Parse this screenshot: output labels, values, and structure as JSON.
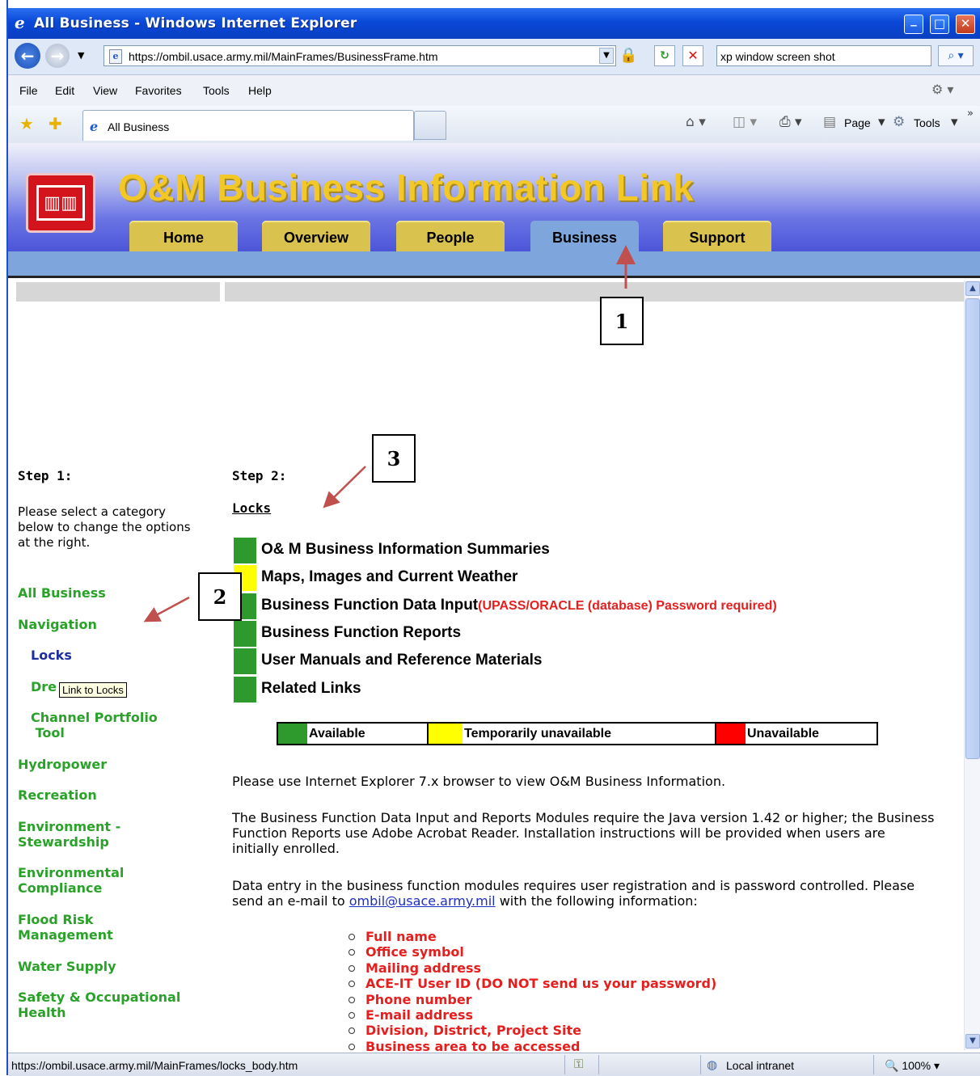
{
  "window": {
    "title": "All Business - Windows Internet Explorer"
  },
  "address_bar": {
    "url": "https://ombil.usace.army.mil/MainFrames/BusinessFrame.htm",
    "search_value": "xp window screen shot"
  },
  "menu": {
    "file": "File",
    "edit": "Edit",
    "view": "View",
    "favorites": "Favorites",
    "tools": "Tools",
    "help": "Help"
  },
  "tabs": {
    "active_label": "All Business"
  },
  "command_bar": {
    "page": "Page",
    "tools": "Tools"
  },
  "site": {
    "title": "O&M Business Information Link",
    "nav": [
      "Home",
      "Overview",
      "People",
      "Business",
      "Support"
    ],
    "active_nav": "Business"
  },
  "left_panel": {
    "step_label": "Step 1:",
    "description": "Please select a category below to change the options at the right.",
    "categories": {
      "all_business": "All Business",
      "navigation": "Navigation",
      "locks": "Locks",
      "dredging_partial": "Dre",
      "channel": "Channel Portfolio\n Tool",
      "hydropower": "Hydropower",
      "recreation": "Recreation",
      "environment": "Environment -\nStewardship",
      "env_compliance": "Environmental\nCompliance",
      "flood": "Flood Risk\nManagement",
      "water": "Water Supply",
      "safety": "Safety & Occupational\nHealth"
    },
    "tooltip": "Link to Locks"
  },
  "right_panel": {
    "step_label": "Step 2:",
    "selected_category": "Locks",
    "options": [
      {
        "label": "O& M Business Information Summaries",
        "status_color": "#2e9a2e",
        "note": ""
      },
      {
        "label": "Maps, Images and Current Weather",
        "status_color": "#ffff00",
        "note": ""
      },
      {
        "label": "Business Function Data Input",
        "status_color": "#2e9a2e",
        "note": "(UPASS/ORACLE (database) Password required)"
      },
      {
        "label": "Business Function Reports",
        "status_color": "#2e9a2e",
        "note": ""
      },
      {
        "label": "User Manuals and Reference Materials",
        "status_color": "#2e9a2e",
        "note": ""
      },
      {
        "label": "Related Links",
        "status_color": "#2e9a2e",
        "note": ""
      }
    ],
    "legend": {
      "available": {
        "label": "Available",
        "color": "#2e9a2e"
      },
      "temp": {
        "label": "Temporarily unavailable",
        "color": "#ffff00"
      },
      "unavailable": {
        "label": "Unavailable",
        "color": "#ff0000"
      }
    },
    "para1": "Please use Internet Explorer 7.x browser to view O&M Business Information.",
    "para2": "The Business Function Data Input and Reports Modules require the Java version 1.42 or higher; the Business Function Reports use Adobe Acrobat Reader. Installation instructions will be provided when users are initially enrolled.",
    "para3_before": "Data entry in the business function modules requires user registration and is password controlled.  Please send an e-mail to ",
    "para3_link": "ombil@usace.army.mil",
    "para3_after": " with the following information:",
    "requirements": [
      "Full name",
      "Office symbol",
      "Mailing address",
      "ACE-IT User ID (DO NOT send us your password)",
      "Phone number",
      "E-mail address",
      "Division, District, Project Site",
      "Business area to be accessed"
    ]
  },
  "callouts": {
    "one": "1",
    "two": "2",
    "three": "3"
  },
  "status_bar": {
    "url": "https://ombil.usace.army.mil/MainFrames/locks_body.htm",
    "zone": "Local intranet",
    "zoom": "100%"
  }
}
